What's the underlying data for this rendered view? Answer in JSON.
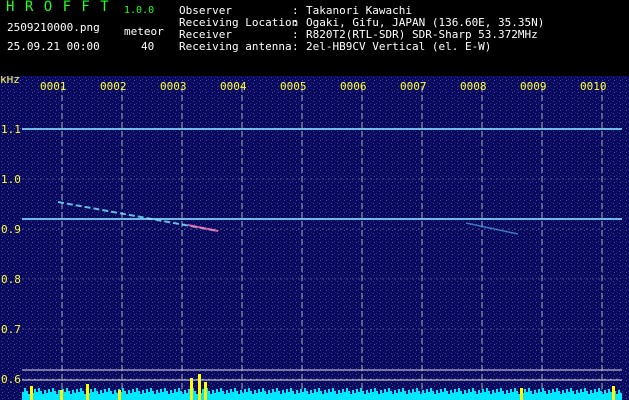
{
  "header": {
    "logo": "H R O F F T",
    "version": "1.0.0",
    "filename": "2509210000.png",
    "datetime": "25.09.21 00:00",
    "meteor_label": "meteor",
    "meteor_count": "40",
    "info": [
      {
        "key": "Observer",
        "value": "Takanori Kawachi"
      },
      {
        "key": "Receiving Location",
        "value": "Ogaki, Gifu, JAPAN (136.60E, 35.35N)"
      },
      {
        "key": "Receiver",
        "value": "R820T2(RTL-SDR) SDR-Sharp 53.372MHz"
      },
      {
        "key": "Receiving antenna",
        "value": "2el-HB9CV Vertical (el. E-W)"
      }
    ],
    "separator": ":"
  },
  "spectrogram": {
    "unit": "kHz",
    "y_ticks": [
      "1.1",
      "1.0",
      "0.9",
      "0.8",
      "0.7",
      "0.6"
    ],
    "x_ticks": [
      "0001",
      "0002",
      "0003",
      "0004",
      "0005",
      "0006",
      "0007",
      "0008",
      "0009",
      "0010"
    ],
    "colors": {
      "background": "#0a0a5a",
      "grid": "#c8c8c8",
      "text": "#ffff33",
      "histogram": "#00e8ff",
      "peak": "#ffff00"
    }
  }
}
